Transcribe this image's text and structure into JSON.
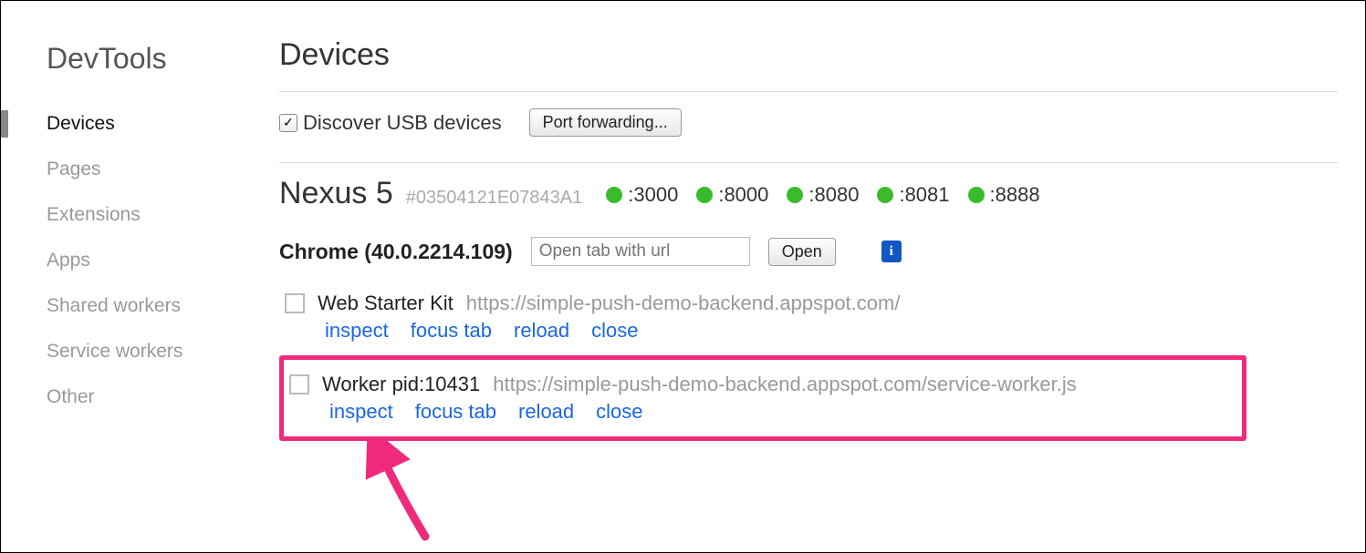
{
  "sidebar": {
    "title": "DevTools",
    "items": [
      {
        "label": "Devices",
        "active": true
      },
      {
        "label": "Pages",
        "active": false
      },
      {
        "label": "Extensions",
        "active": false
      },
      {
        "label": "Apps",
        "active": false
      },
      {
        "label": "Shared workers",
        "active": false
      },
      {
        "label": "Service workers",
        "active": false
      },
      {
        "label": "Other",
        "active": false
      }
    ]
  },
  "main": {
    "title": "Devices",
    "discover_label": "Discover USB devices",
    "discover_checked": true,
    "port_forwarding_label": "Port forwarding...",
    "device": {
      "name": "Nexus 5",
      "id": "#03504121E07843A1",
      "ports": [
        ":3000",
        ":8000",
        ":8080",
        ":8081",
        ":8888"
      ],
      "port_status_color": "#3bbb2c"
    },
    "browser": {
      "name": "Chrome (40.0.2214.109)",
      "url_placeholder": "Open tab with url",
      "open_label": "Open"
    },
    "targets": [
      {
        "title": "Web Starter Kit",
        "url": "https://simple-push-demo-backend.appspot.com/",
        "actions": [
          "inspect",
          "focus tab",
          "reload",
          "close"
        ],
        "highlighted": false
      },
      {
        "title": "Worker pid:10431",
        "url": "https://simple-push-demo-backend.appspot.com/service-worker.js",
        "actions": [
          "inspect",
          "focus tab",
          "reload",
          "close"
        ],
        "highlighted": true
      }
    ]
  },
  "annotation": {
    "arrow_color": "#ef2a7b"
  }
}
